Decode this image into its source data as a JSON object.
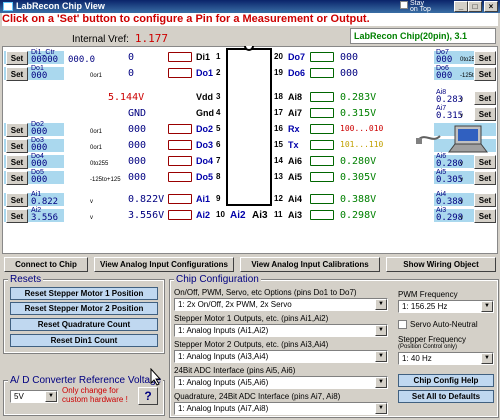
{
  "window": {
    "title": "LabRecon Chip View",
    "stay_on_top": "Stay\non Top",
    "minimize": "_",
    "maximize": "□",
    "close": "×"
  },
  "instruction": "Click on a 'Set' button to configure a Pin for a Measurement or Output.",
  "vref": {
    "label": "Internal Vref:",
    "value": "1.177"
  },
  "chip_name": "LabRecon Chip(20pin), 3.1",
  "set_label": "Set",
  "left_rows": [
    {
      "label": "Di1_Ctr",
      "value": "00000",
      "value2": "000.0",
      "disp": "0",
      "pin": "Di1",
      "num": "1",
      "highlight": true
    },
    {
      "label": "Do1",
      "value": "000",
      "sub": "0or1",
      "disp": "0",
      "pin": "Do1",
      "num": "2"
    },
    {
      "label": "",
      "value": "",
      "disp": "5.144V",
      "pin": "Vdd",
      "num": "3",
      "pin_label": "5V"
    },
    {
      "label": "",
      "value": "",
      "disp": "GND",
      "pin": "Gnd",
      "num": "4",
      "pin_label": "Gnd"
    },
    {
      "label": "Do2",
      "value": "000",
      "sub": "0or1",
      "disp": "000",
      "pin": "Do2",
      "num": "5",
      "pin_label": "RX"
    },
    {
      "label": "Do3",
      "value": "000",
      "sub": "0or1",
      "disp": "000",
      "pin": "Do3",
      "num": "6",
      "pin_label": "TX"
    },
    {
      "label": "Do4",
      "value": "000",
      "sub": "0to255",
      "disp": "000",
      "pin": "Do4",
      "num": "7"
    },
    {
      "label": "Do5",
      "value": "000",
      "sub": "-125to+125",
      "disp": "000",
      "pin": "Do5",
      "num": "8"
    },
    {
      "label": "Ai1",
      "value": "0.822",
      "sub": "v",
      "disp": "0.822V",
      "pin": "Ai1",
      "num": "9"
    },
    {
      "label": "Ai2",
      "value": "3.556",
      "sub": "v",
      "disp": "3.556V",
      "pin": "Ai2",
      "num": "10"
    }
  ],
  "right_rows": [
    {
      "num": "20",
      "pin": "Do7",
      "disp": "000",
      "label": "Do7",
      "value": "000",
      "sub": "0to255"
    },
    {
      "num": "19",
      "pin": "Do6",
      "disp": "000",
      "label": "Do6",
      "value": "000",
      "sub": "-125to+125"
    },
    {
      "num": "18",
      "pin": "Ai8",
      "disp": "0.283V",
      "label": "Ai8",
      "value": "0.283",
      "sub": "v"
    },
    {
      "num": "17",
      "pin": "Ai7",
      "disp": "0.315V",
      "label": "Ai7",
      "value": "0.315",
      "sub": "v"
    },
    {
      "num": "16",
      "pin": "Rx",
      "disp": "100...010",
      "label": "",
      "value": ""
    },
    {
      "num": "15",
      "pin": "Tx",
      "disp": "101...110",
      "label": "",
      "value": ""
    },
    {
      "num": "14",
      "pin": "Ai6",
      "disp": "0.280V",
      "label": "Ai6",
      "value": "0.280",
      "sub": "v"
    },
    {
      "num": "13",
      "pin": "Ai5",
      "disp": "0.305V",
      "label": "Ai5",
      "value": "0.305",
      "sub": "v"
    },
    {
      "num": "12",
      "pin": "Ai4",
      "disp": "0.388V",
      "label": "Ai4",
      "value": "0.388",
      "sub": "v"
    },
    {
      "num": "11",
      "pin": "Ai3",
      "disp": "0.298V",
      "label": "Ai3",
      "value": "0.298",
      "sub": "v"
    }
  ],
  "left_pin_labels": [
    "Di1",
    "Do1",
    "5V",
    "Gnd",
    "Do2",
    "Do3",
    "Do4",
    "Do5",
    "Ai1",
    "Ai2"
  ],
  "right_pin_labels": [
    "Do7",
    "Do6",
    "Ai8",
    "Ai7",
    "RX",
    "TX",
    "Ai6",
    "Ai5",
    "Ai4",
    "Ai3"
  ],
  "toolbar": {
    "connect": "Connect to Chip",
    "analog_configs": "View Analog Input Configurations",
    "analog_cals": "View Analog Input Calibrations",
    "wiring": "Show Wiring Object"
  },
  "resets": {
    "title": "Resets",
    "b1": "Reset Stepper Motor 1 Position",
    "b2": "Reset Stepper Motor 2 Position",
    "b3": "Reset Quadrature Count",
    "b4": "Reset Din1 Count"
  },
  "adc": {
    "title": "A/ D Converter Reference Voltage",
    "value": "5V",
    "warning": "Only change for custom hardware !",
    "help": "?"
  },
  "config": {
    "title": "Chip Configuration",
    "onoff_label": "On/Off, PWM, Servo, etc Options (pins Do1 to Do7)",
    "onoff_value": "1:  2x On/Off,    2x PWM,        2x Servo",
    "stepper1_label": "Stepper Motor 1 Outputs, etc. (pins Ai1,Ai2)",
    "stepper1_value": "1:  Analog Inputs (Ai1,Ai2)",
    "stepper2_label": "Stepper Motor 2 Outputs, etc. (pins Ai3,Ai4)",
    "stepper2_value": "1:  Analog Inputs (Ai3,Ai4)",
    "adc24_label": "24Bit ADC Interface (pins Ai5, Ai6)",
    "adc24_value": "1:  Analog Inputs (Ai5,Ai6)",
    "quad_label": "Quadrature, 24Bit ADC Interface (pins Ai7, Ai8)",
    "quad_value": "1:  Analog Inputs (Ai7,Ai8)",
    "pwm_label": "PWM Frequency",
    "pwm_value": "1:  156.25 Hz",
    "servo_label": "Servo Auto-Neutral",
    "stepper_freq_label": "Stepper Frequency",
    "stepper_freq_sub": "(Position Control only)",
    "stepper_freq_value": "1:  40 Hz",
    "help_btn": "Chip Config Help",
    "defaults_btn": "Set All to Defaults"
  }
}
